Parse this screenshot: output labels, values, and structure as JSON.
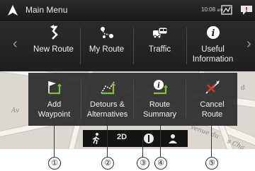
{
  "title_bar": {
    "title": "Main Menu",
    "clock": "10:08",
    "clock_suffix": "am"
  },
  "menu": {
    "items": [
      {
        "label": "New Route",
        "icon": "new-route-icon"
      },
      {
        "label": "My Route",
        "icon": "my-route-icon"
      },
      {
        "label": "Traffic",
        "icon": "traffic-icon"
      },
      {
        "label_line1": "Useful",
        "label_line2": "Information",
        "icon": "info-icon"
      }
    ]
  },
  "popup": {
    "buttons": [
      {
        "label_line1": "Add",
        "label_line2": "Waypoint",
        "icon": "add-waypoint-icon"
      },
      {
        "label_line1": "Detours &",
        "label_line2": "Alternatives",
        "icon": "detours-icon"
      },
      {
        "label_line1": "Route",
        "label_line2": "Summary",
        "icon": "route-summary-icon"
      },
      {
        "label_line1": "Cancel",
        "label_line2": "Route",
        "icon": "cancel-route-icon"
      }
    ]
  },
  "bottom_bar": {
    "view_mode": "2D"
  },
  "map": {
    "street_label_1": "Av",
    "street_label_2": "venue du",
    "street_label_3": "s Cha"
  },
  "callouts": [
    "①",
    "②",
    "③",
    "④",
    "⑤"
  ],
  "colors": {
    "accent_green": "#7dc242",
    "cancel_red": "#d9342b",
    "panel_bg": "#2a2a2a"
  }
}
